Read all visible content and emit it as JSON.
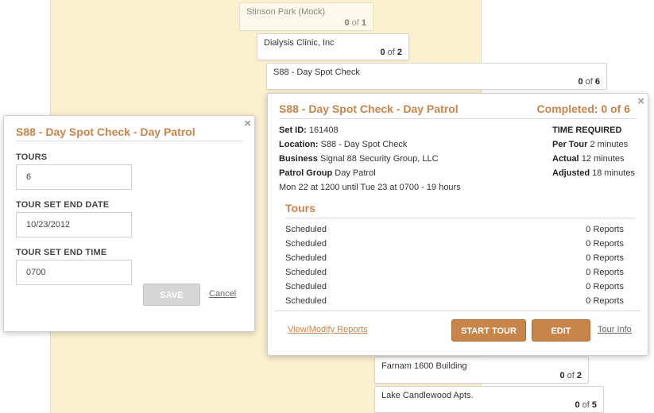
{
  "background_cards": [
    {
      "name": "Stinson Park (Mock)",
      "done": "0",
      "of": "of",
      "total": "1"
    },
    {
      "name": "Dialysis Clinic, Inc",
      "done": "0",
      "of": "of",
      "total": "2"
    },
    {
      "name": "S88 - Day Spot Check",
      "done": "0",
      "of": "of",
      "total": "6"
    },
    {
      "name": "Farnam 1600 Building",
      "done": "0",
      "of": "of",
      "total": "2"
    },
    {
      "name": "Lake Candlewood Apts.",
      "done": "0",
      "of": "of",
      "total": "5"
    }
  ],
  "edit_panel": {
    "title": "S88 - Day Spot Check - Day Patrol",
    "close": "×",
    "tours_label": "TOURS",
    "tours_value": "6",
    "end_date_label": "TOUR SET END DATE",
    "end_date_value": "10/23/2012",
    "end_time_label": "TOUR SET END TIME",
    "end_time_value": "0700",
    "save": "SAVE",
    "cancel": "Cancel"
  },
  "detail_panel": {
    "title": "S88 - Day Spot Check - Day Patrol",
    "completed": "Completed: 0 of 6",
    "close": "×",
    "set_id_label": "Set ID:",
    "set_id": "161408",
    "location_label": "Location:",
    "location": "S88 - Day Spot Check",
    "business_label": "Business",
    "business": "Signal 88 Security Group, LLC",
    "patrol_group_label": "Patrol Group",
    "patrol_group": "Day Patrol",
    "schedule": "Mon 22 at 1200 until Tue 23 at 0700 - 19 hours",
    "time_required": "TIME REQUIRED",
    "per_tour_label": "Per Tour",
    "per_tour": "2 minutes",
    "actual_label": "Actual",
    "actual": "12 minutes",
    "adjusted_label": "Adjusted",
    "adjusted": "18 minutes",
    "tours_title": "Tours",
    "tours": [
      {
        "status": "Scheduled",
        "reports": "0 Reports"
      },
      {
        "status": "Scheduled",
        "reports": "0 Reports"
      },
      {
        "status": "Scheduled",
        "reports": "0 Reports"
      },
      {
        "status": "Scheduled",
        "reports": "0 Reports"
      },
      {
        "status": "Scheduled",
        "reports": "0 Reports"
      },
      {
        "status": "Scheduled",
        "reports": "0 Reports"
      }
    ],
    "view_modify_reports": "View/Modify Reports",
    "start_tour": "START TOUR",
    "edit": "EDIT",
    "tour_info": "Tour Info"
  },
  "colors": {
    "accent": "#c8854a",
    "band": "#fbf1cf"
  }
}
